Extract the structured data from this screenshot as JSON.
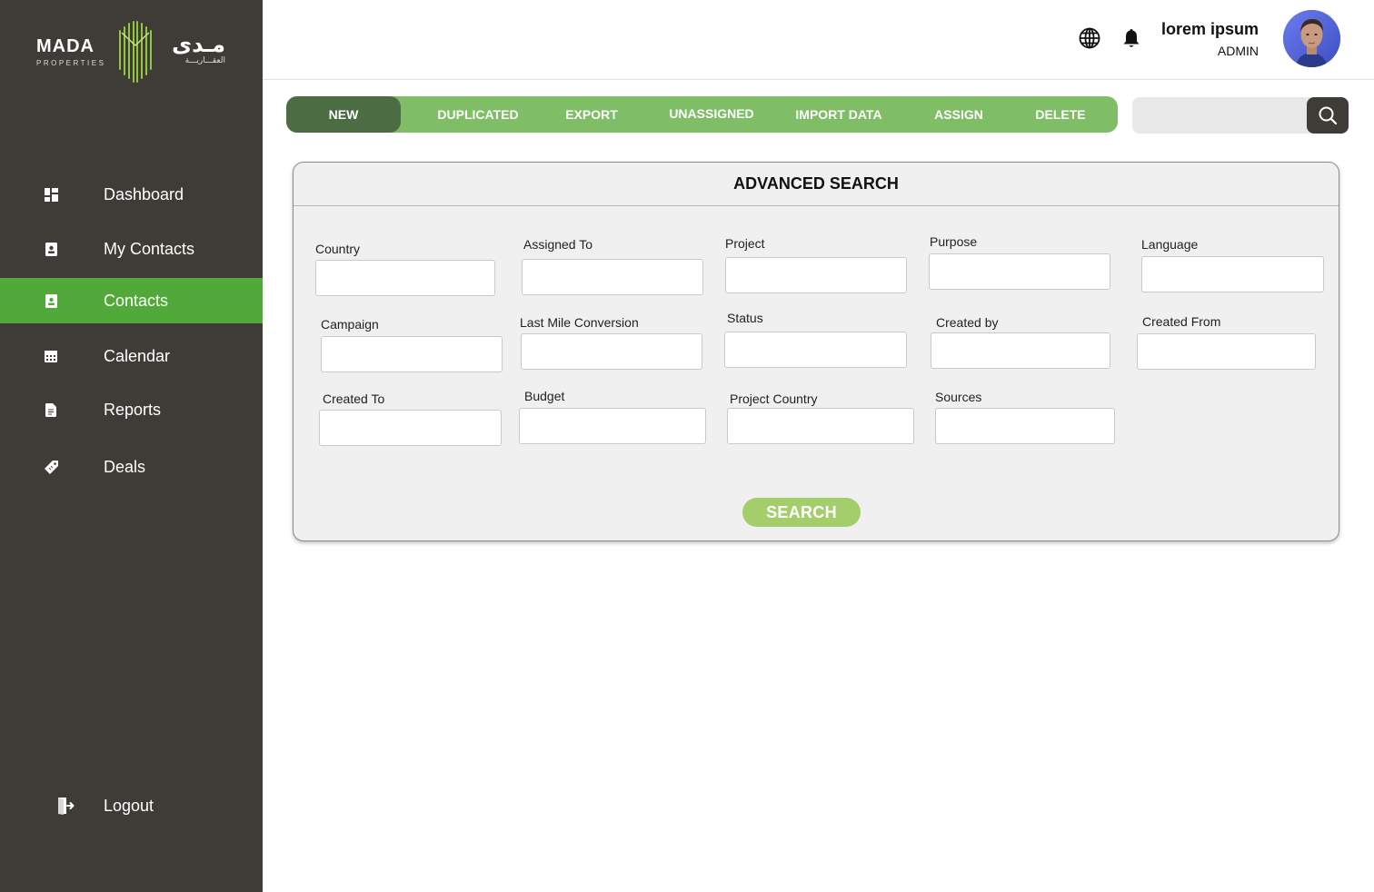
{
  "brand": {
    "name_en": "MADA",
    "sub_en": "PROPERTIES",
    "name_ar": "مـدى",
    "sub_ar": "العقـــاريـــة"
  },
  "sidebar": {
    "items": [
      {
        "label": "Dashboard",
        "icon": "dashboard-icon"
      },
      {
        "label": "My Contacts",
        "icon": "contact-card-icon"
      },
      {
        "label": "Contacts",
        "icon": "contact-card-icon",
        "active": true
      },
      {
        "label": "Calendar",
        "icon": "calendar-icon"
      },
      {
        "label": "Reports",
        "icon": "report-icon"
      },
      {
        "label": "Deals",
        "icon": "tag-icon"
      }
    ],
    "logout": {
      "label": "Logout",
      "icon": "logout-icon"
    }
  },
  "header": {
    "user_name": "lorem ipsum",
    "user_role": "ADMIN",
    "icons": [
      "globe-icon",
      "bell-icon"
    ]
  },
  "toolbar": {
    "buttons": [
      "NEW",
      "DUPLICATED",
      "EXPORT",
      "UNASSIGNED",
      "IMPORT DATA",
      "ASSIGN",
      "DELETE"
    ],
    "active": "NEW"
  },
  "search": {
    "placeholder": "",
    "value": ""
  },
  "advanced_search": {
    "title": "ADVANCED SEARCH",
    "fields": {
      "country": "Country",
      "assigned_to": "Assigned To",
      "project": "Project",
      "purpose": "Purpose",
      "language": "Language",
      "campaign": "Campaign",
      "last_mile_conversion": "Last Mile Conversion",
      "status": "Status",
      "created_by": "Created by",
      "created_from": "Created From",
      "created_to": "Created To",
      "budget": "Budget",
      "project_country": "Project Country",
      "sources": "Sources"
    },
    "submit_label": "SEARCH"
  },
  "colors": {
    "sidebar_bg": "#3f3c37",
    "active_nav": "#51a93a",
    "toolbar_bg": "#80bd67",
    "toolbar_active": "#4c6d43",
    "search_submit": "#a4ce6c"
  }
}
